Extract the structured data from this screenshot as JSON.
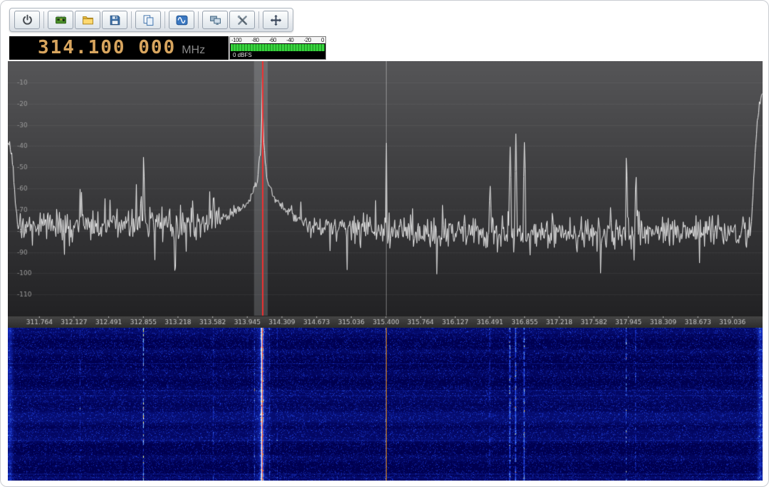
{
  "toolbar": {
    "icons": [
      "power",
      "source-device",
      "open-file",
      "save",
      "copy-pages",
      "waveform",
      "remote-display",
      "tools",
      "pan-move"
    ]
  },
  "frequency_display": {
    "value": "314.100 000",
    "unit": "MHz",
    "digit_color": "#d8a55e"
  },
  "meter": {
    "scale_labels": [
      "-100",
      "-80",
      "-60",
      "-40",
      "-20",
      "0"
    ],
    "caption": "0 dBFS",
    "bar_bright": "#38d23e",
    "bar_dark": "#1a8f1e"
  },
  "spectrum": {
    "fmin": 311.433,
    "fmax": 319.352,
    "db_top": 0,
    "db_bottom": -120,
    "noise_floor_db": -79,
    "tuned_freq": 314.1,
    "tuned_line_color": "#f03030",
    "selection_band": [
      314.016,
      314.16
    ],
    "marker_freq": 315.4,
    "db_labels": [
      "-10",
      "-20",
      "-30",
      "-40",
      "-50",
      "-60",
      "-70",
      "-80",
      "-90",
      "-100",
      "-110"
    ],
    "freq_labels": [
      "311.764",
      "312.127",
      "312.491",
      "312.855",
      "313.218",
      "313.582",
      "313.945",
      "314.309",
      "314.673",
      "315.036",
      "315.400",
      "315.764",
      "316.127",
      "316.491",
      "316.855",
      "317.218",
      "317.582",
      "317.945",
      "318.309",
      "318.673",
      "319.036"
    ],
    "signals": [
      {
        "f": 314.1,
        "db": -8,
        "w": 0.006
      },
      {
        "f": 314.1,
        "db": -38,
        "w": 0.035
      },
      {
        "f": 314.1,
        "db": -55,
        "w": 0.12
      },
      {
        "f": 314.1,
        "db": -66,
        "w": 0.4
      },
      {
        "f": 312.855,
        "db": -44,
        "w": 0.005
      },
      {
        "f": 312.19,
        "db": -57,
        "w": 0.004
      },
      {
        "f": 313.59,
        "db": -63,
        "w": 0.012
      },
      {
        "f": 315.4,
        "db": -37,
        "w": 0.004
      },
      {
        "f": 316.49,
        "db": -57,
        "w": 0.008
      },
      {
        "f": 316.7,
        "db": -42,
        "w": 0.007
      },
      {
        "f": 316.76,
        "db": -33,
        "w": 0.006
      },
      {
        "f": 316.85,
        "db": -39,
        "w": 0.007
      },
      {
        "f": 317.92,
        "db": -43,
        "w": 0.005
      },
      {
        "f": 318.02,
        "db": -55,
        "w": 0.008
      },
      {
        "f": 311.44,
        "db": -39,
        "w": 0.045
      },
      {
        "f": 319.3,
        "db": -34,
        "w": 0.012
      },
      {
        "f": 319.345,
        "db": -16,
        "w": 0.05
      }
    ]
  },
  "waterfall": {
    "tuned_line_color": "rgba(225,40,40,0.95)",
    "marker_line_color": "rgba(255,150,0,0.95)",
    "palette": [
      [
        0.0,
        "#000050"
      ],
      [
        0.32,
        "#1228b4"
      ],
      [
        0.5,
        "#2448e0"
      ],
      [
        0.62,
        "#4880f0"
      ],
      [
        0.72,
        "#90d8f8"
      ],
      [
        0.8,
        "#f8f860"
      ],
      [
        0.88,
        "#ffa000"
      ],
      [
        0.94,
        "#ff2800"
      ],
      [
        1.0,
        "#ffffff"
      ]
    ],
    "signals": [
      {
        "f": 314.1,
        "amp": 50,
        "w": 0.004,
        "duty": 1
      },
      {
        "f": 314.1,
        "amp": 44,
        "w": 0.014,
        "duty": 1
      },
      {
        "f": 314.1,
        "amp": 10,
        "w": 0.06,
        "duty": 1
      },
      {
        "f": 314.02,
        "amp": 22,
        "w": 0.004,
        "duty": 0.55
      },
      {
        "f": 314.18,
        "amp": 22,
        "w": 0.004,
        "duty": 0.55
      },
      {
        "f": 313.95,
        "amp": 12,
        "w": 0.004,
        "duty": 0.4
      },
      {
        "f": 314.26,
        "amp": 12,
        "w": 0.004,
        "duty": 0.4
      },
      {
        "f": 315.4,
        "amp": 44,
        "w": 0.0035,
        "duty": 1
      },
      {
        "f": 312.855,
        "amp": 36,
        "w": 0.005,
        "duty": 0.6
      },
      {
        "f": 312.19,
        "amp": 20,
        "w": 0.0035,
        "duty": 0.4
      },
      {
        "f": 313.59,
        "amp": 16,
        "w": 0.005,
        "duty": 0.4
      },
      {
        "f": 316.49,
        "amp": 22,
        "w": 0.005,
        "duty": 0.5
      },
      {
        "f": 316.7,
        "amp": 34,
        "w": 0.006,
        "duty": 0.85
      },
      {
        "f": 316.76,
        "amp": 40,
        "w": 0.005,
        "duty": 0.85
      },
      {
        "f": 316.85,
        "amp": 34,
        "w": 0.006,
        "duty": 0.85
      },
      {
        "f": 317.92,
        "amp": 34,
        "w": 0.0045,
        "duty": 0.5
      },
      {
        "f": 318.02,
        "amp": 20,
        "w": 0.005,
        "duty": 0.5
      },
      {
        "f": 311.45,
        "amp": 14,
        "w": 0.035,
        "duty": 1
      },
      {
        "f": 319.33,
        "amp": 16,
        "w": 0.03,
        "duty": 1
      }
    ]
  }
}
